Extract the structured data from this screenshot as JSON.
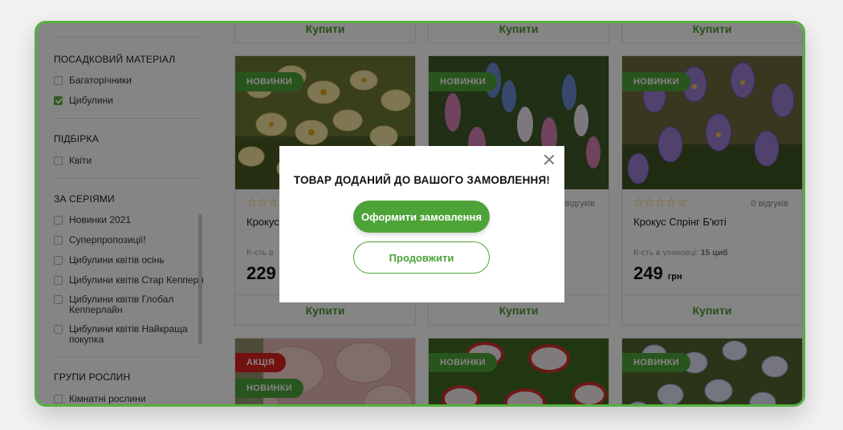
{
  "sidebar": {
    "groups": [
      {
        "heading": "ПОСАДКОВИЙ МАТЕРІАЛ",
        "options": [
          {
            "label": "Багаторічники",
            "checked": false
          },
          {
            "label": "Цибулини",
            "checked": true
          }
        ]
      },
      {
        "heading": "ПІДБІРКА",
        "options": [
          {
            "label": "Квіти",
            "checked": false
          }
        ]
      },
      {
        "heading": "ЗА СЕРІЯМИ",
        "options": [
          {
            "label": "Новинки 2021",
            "checked": false
          },
          {
            "label": "Суперпропозиції!",
            "checked": false
          },
          {
            "label": "Цибулини квітів осінь",
            "checked": false
          },
          {
            "label": "Цибулини квітів Стар Кепперл",
            "checked": false
          },
          {
            "label": "Цибулини квітів Глобал Кепперлайн",
            "checked": false
          },
          {
            "label": "Цибулини квітів Найкраща покупка",
            "checked": false
          }
        ]
      },
      {
        "heading": "ГРУПИ РОСЛИН",
        "options": [
          {
            "label": "Кімнатні рослини",
            "checked": false
          }
        ]
      }
    ]
  },
  "buy_label": "Купити",
  "products": [
    {
      "badges": [
        "НОВИНКИ"
      ],
      "name": "Крокус",
      "qty_label": "К-сть в",
      "qty_value": "",
      "price": "229",
      "currency": "",
      "reviews": "",
      "image": "yellow-crocus"
    },
    {
      "badges": [
        "НОВИНКИ"
      ],
      "name": "",
      "qty_label": "",
      "qty_value": "",
      "price": "",
      "currency": "",
      "reviews": "відгуків",
      "image": "mixed-hyacinths"
    },
    {
      "badges": [
        "НОВИНКИ"
      ],
      "name": "Крокус Спрінг Б'юті",
      "qty_label": "К-сть в упаковці:",
      "qty_value": "15 циб",
      "price": "249",
      "currency": "грн",
      "reviews": "0 відгуків",
      "image": "purple-crocus"
    }
  ],
  "bottom_products": [
    {
      "badges": [
        "АКЦІЯ",
        "НОВИНКИ"
      ],
      "image": "pink-tulip"
    },
    {
      "badges": [
        "НОВИНКИ"
      ],
      "image": "striped-tulip"
    },
    {
      "badges": [
        "НОВИНКИ"
      ],
      "image": "pale-crocus"
    }
  ],
  "modal": {
    "title": "ТОВАР ДОДАНИЙ ДО ВАШОГО ЗАМОВЛЕННЯ!",
    "primary_button": "Оформити замовлення",
    "secondary_button": "Продовжити"
  },
  "colors": {
    "accent": "#4ea338",
    "sale": "#dd1f1f",
    "star": "#f1b10e"
  }
}
